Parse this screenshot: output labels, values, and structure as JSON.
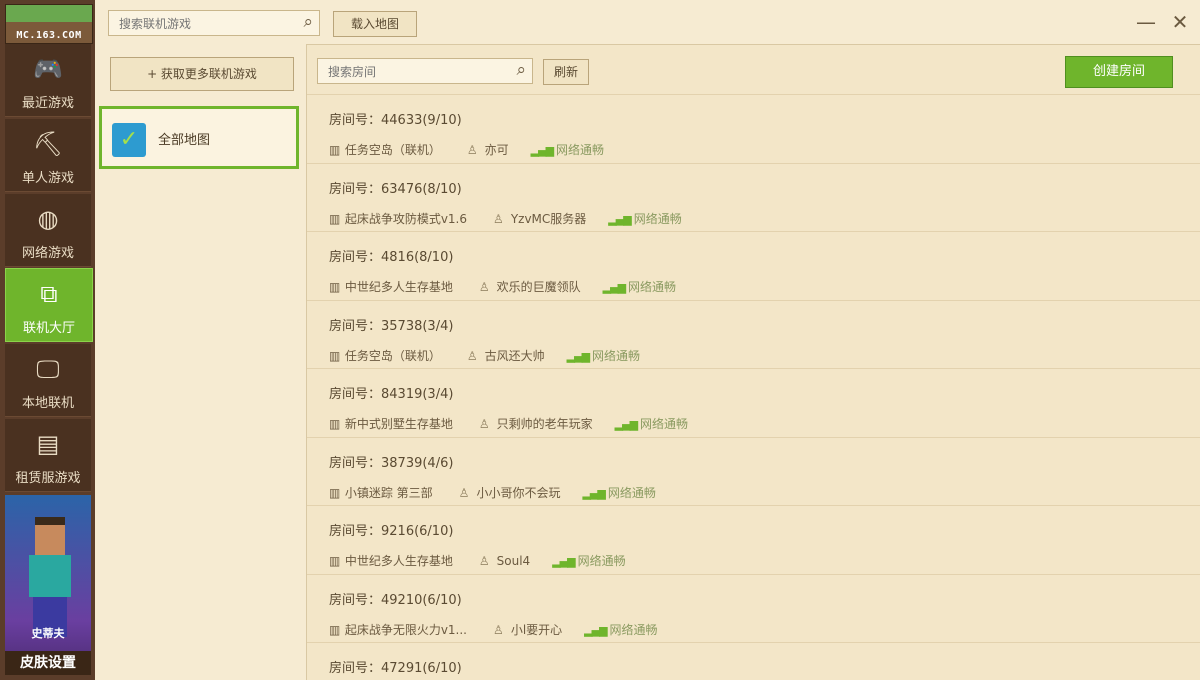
{
  "app": {
    "logo_text": "MC.163.COM"
  },
  "nav": {
    "items": [
      {
        "label": "最近游戏",
        "icon": "gamepad-icon"
      },
      {
        "label": "单人游戏",
        "icon": "pickaxe-icon"
      },
      {
        "label": "网络游戏",
        "icon": "globe-icon"
      },
      {
        "label": "联机大厅",
        "icon": "network-icon"
      },
      {
        "label": "本地联机",
        "icon": "monitor-icon"
      },
      {
        "label": "租赁服游戏",
        "icon": "server-icon"
      }
    ],
    "active_index": 3,
    "skin_name": "史蒂夫",
    "skin_button": "皮肤设置"
  },
  "topbar": {
    "search_placeholder": "搜索联机游戏",
    "import_map_button": "载入地图"
  },
  "sidebar": {
    "get_more_button": "+ 获取更多联机游戏",
    "all_maps_label": "全部地图"
  },
  "main": {
    "room_search_placeholder": "搜索房间",
    "refresh_button": "刷新",
    "create_room_button": "创建房间",
    "room_prefix": "房间号：",
    "signal_text": "网络通畅",
    "rooms": [
      {
        "id": "44633(9/10)",
        "map": "任务空岛（联机）",
        "host": "亦可"
      },
      {
        "id": "63476(8/10)",
        "map": "起床战争攻防模式v1.6",
        "host": "YzvMC服务器"
      },
      {
        "id": "4816(8/10)",
        "map": "中世纪多人生存基地",
        "host": "欢乐的巨魔领队"
      },
      {
        "id": "35738(3/4)",
        "map": "任务空岛（联机）",
        "host": "古风还大帅"
      },
      {
        "id": "84319(3/4)",
        "map": "新中式别墅生存基地",
        "host": "只剩帅的老年玩家"
      },
      {
        "id": "38739(4/6)",
        "map": "小镇迷踪 第三部",
        "host": "小小哥你不会玩"
      },
      {
        "id": "9216(6/10)",
        "map": "中世纪多人生存基地",
        "host": "Soul4"
      },
      {
        "id": "49210(6/10)",
        "map": "起床战争无限火力v1...",
        "host": "小l要开心"
      },
      {
        "id": "47291(6/10)",
        "map": "",
        "host": ""
      }
    ]
  }
}
